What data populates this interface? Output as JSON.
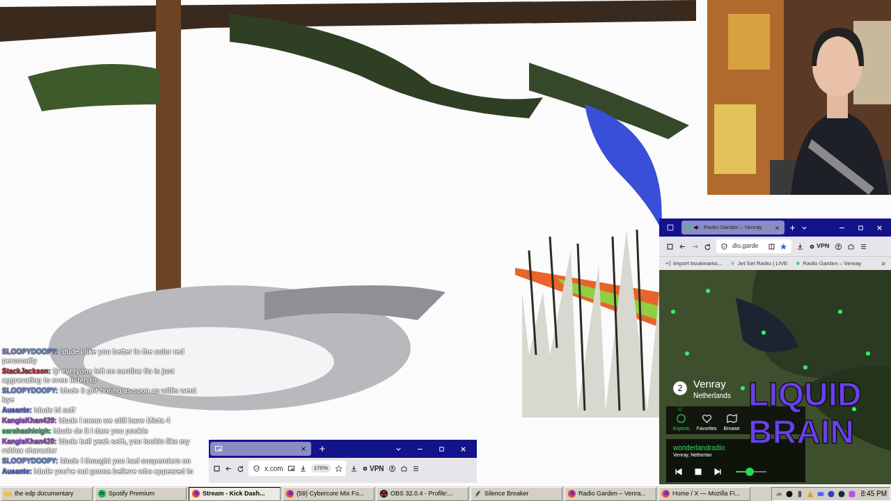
{
  "chat": [
    {
      "user": "SLOOPYDOOPY:",
      "color": "#6f8fd8",
      "message": "!dude i like you better in the color red personally"
    },
    {
      "user": "StackJackson:",
      "color": "#d0203a",
      "message": "!jr everyone left on sardine tin is just aggravating to even listen to"
    },
    {
      "user": "SLOOPYDOOPY:",
      "color": "#6f8fd8",
      "message": "!dude it got boring as soon as willis went bye"
    },
    {
      "user": "Ausante:",
      "color": "#5a6ad8",
      "message": "!dude hi seff"
    },
    {
      "user": "KangisKhan420:",
      "color": "#a24fd8",
      "message": "!dude I mean we still have Mista 4"
    },
    {
      "user": "sarahashleigh:",
      "color": "#2fbf6a",
      "message": "!dude do it I dare you pookie"
    },
    {
      "user": "KangisKhan420:",
      "color": "#a24fd8",
      "message": "!dude hell yeah seth, you lookin like my roblox character"
    },
    {
      "user": "SLOOPYDOOPY:",
      "color": "#6f8fd8",
      "message": "!dude I thought you had suspenders on"
    },
    {
      "user": "Ausante:",
      "color": "#5a6ad8",
      "message": "!dude you're not gonna believe who appeared in"
    }
  ],
  "x_window": {
    "url": "x.com",
    "zoom": "170%",
    "vpn": "VPN"
  },
  "radio_window": {
    "tab_title": "Radio Garden – Venray",
    "url": "dio.garde",
    "vpn": "VPN",
    "bookmarks": [
      {
        "label": "Import bookmarks...",
        "kind": "import"
      },
      {
        "label": "Jet Set Radio | LIVE",
        "kind": "radio"
      },
      {
        "label": "Radio Garden – Venray",
        "kind": "dot"
      }
    ],
    "overflow": "»",
    "badge": "2",
    "place": "Venray",
    "country": "Netherlands",
    "nav": [
      {
        "label": "Explore",
        "kind": "explore",
        "selected": true
      },
      {
        "label": "Favorites",
        "kind": "heart",
        "selected": false
      },
      {
        "label": "Browse",
        "kind": "map",
        "selected": false
      }
    ],
    "station": "wonderlandradio",
    "station_place": "Venray, Netherlan",
    "volume": {
      "level": 0.45
    }
  },
  "overlay_logo": {
    "line1": "LIQUID",
    "line2": "BRAIN"
  },
  "taskbar": {
    "items": [
      {
        "label": "the edp documentary",
        "kind": "folder",
        "selected": false
      },
      {
        "label": "Spotify Premium",
        "kind": "spotify",
        "selected": false
      },
      {
        "label": "Stream - Kick Dash...",
        "kind": "firefox",
        "selected": true
      },
      {
        "label": "(59) Cybercore Mix Fo...",
        "kind": "firefox",
        "selected": false
      },
      {
        "label": "OBS 32.0.4 - Profile:...",
        "kind": "obs",
        "selected": false
      },
      {
        "label": "Silence Breaker",
        "kind": "feather",
        "selected": false
      },
      {
        "label": "Radio Garden – Venra...",
        "kind": "firefox",
        "selected": false
      },
      {
        "label": "Home / X — Mozilla Fi...",
        "kind": "firefox",
        "selected": false
      }
    ],
    "clock": "8:45 PM"
  }
}
